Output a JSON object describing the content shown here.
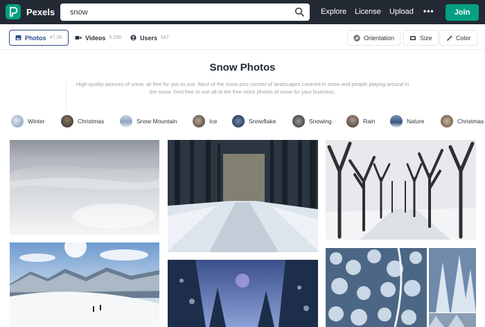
{
  "header": {
    "brand": "Pexels",
    "search_value": "snow",
    "nav": [
      "Explore",
      "License",
      "Upload"
    ],
    "more": "•••",
    "join_label": "Join",
    "brand_color": "#05a081",
    "logo_icon": "pexels-logo-icon",
    "search_icon": "search-icon"
  },
  "tabs": [
    {
      "label": "Photos",
      "count": "47.2K",
      "icon": "photo-icon",
      "active": true
    },
    {
      "label": "Videos",
      "count": "5.15K",
      "icon": "video-icon",
      "active": false
    },
    {
      "label": "Users",
      "count": "547",
      "icon": "user-icon",
      "active": false
    }
  ],
  "filters": [
    {
      "label": "Orientation",
      "icon": "orientation-icon"
    },
    {
      "label": "Size",
      "icon": "size-icon"
    },
    {
      "label": "Color",
      "icon": "color-icon"
    }
  ],
  "page": {
    "title": "Snow Photos",
    "description": "High-quality pictures of snow, all free for you to use. Most of the snow pics consist of landscapes covered in snow and people playing around in the snow. Feel free to use all of the free stock photos of snow for your business."
  },
  "related": [
    "Winter",
    "Christmas",
    "Snow Mountain",
    "Ice",
    "Snowflake",
    "Snowing",
    "Rain",
    "Nature",
    "Christmas"
  ],
  "photos": [
    {
      "id": "snow-surface-photo"
    },
    {
      "id": "snowy-forest-road-photo"
    },
    {
      "id": "tree-avenue-photo"
    },
    {
      "id": "mountain-skiers-photo"
    },
    {
      "id": "forest-night-photo"
    },
    {
      "id": "aerial-forest-photo"
    },
    {
      "id": "frozen-trees-photo"
    }
  ]
}
